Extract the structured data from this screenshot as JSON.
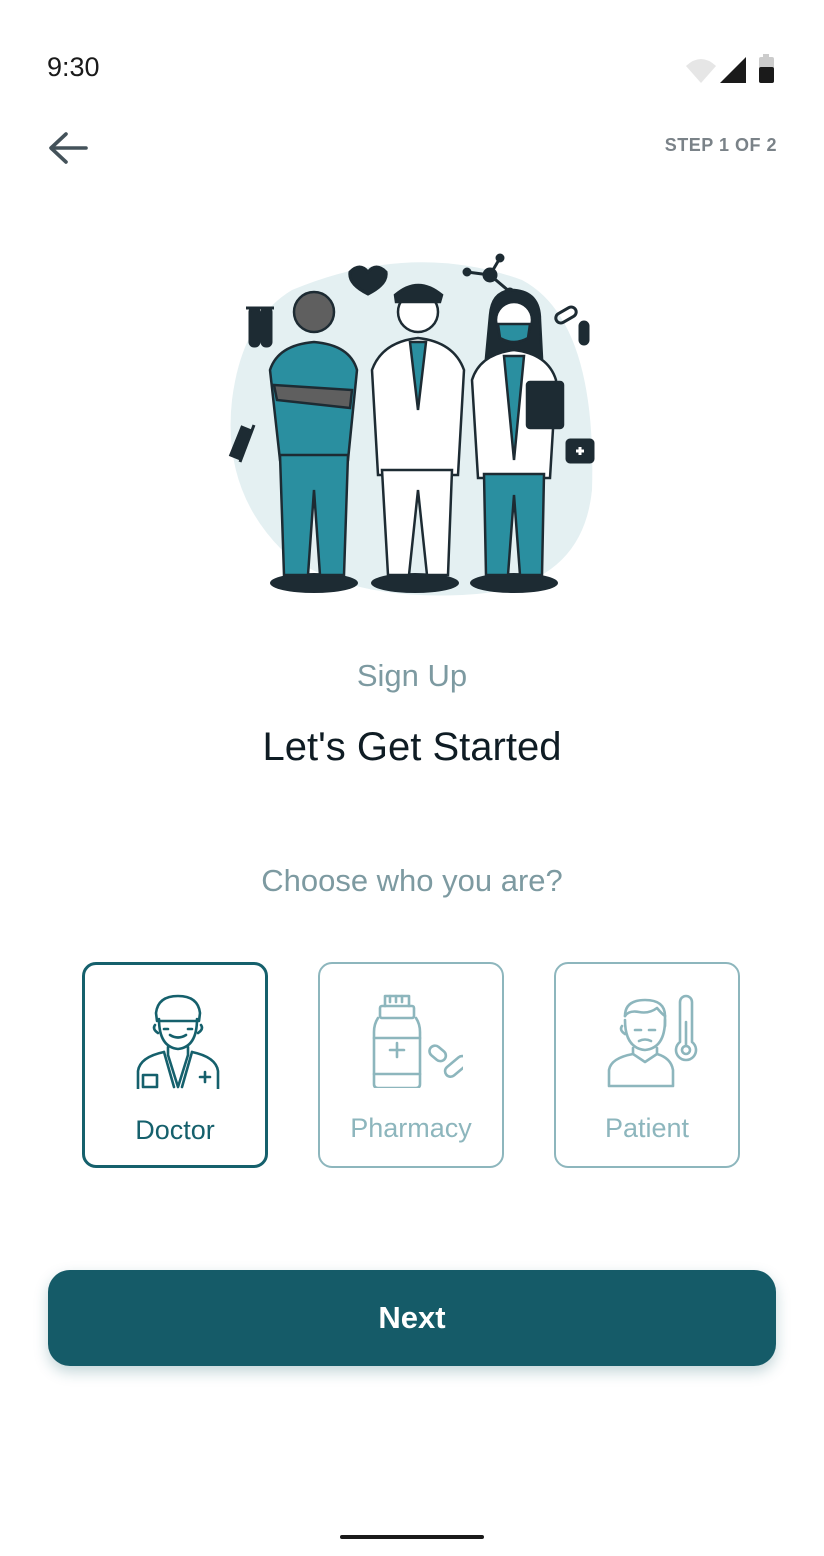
{
  "status_bar": {
    "time": "9:30"
  },
  "header": {
    "step": "STEP 1 OF 2",
    "back_icon": "arrow-left-icon"
  },
  "hero": {
    "illustration": "medical-team-illustration"
  },
  "text": {
    "subtitle": "Sign Up",
    "title": "Let's Get Started",
    "prompt": "Choose who you are?"
  },
  "roles": [
    {
      "label": "Doctor",
      "icon": "doctor-icon",
      "selected": true
    },
    {
      "label": "Pharmacy",
      "icon": "pharmacy-icon",
      "selected": false
    },
    {
      "label": "Patient",
      "icon": "patient-icon",
      "selected": false
    }
  ],
  "actions": {
    "next_label": "Next"
  },
  "colors": {
    "primary": "#155b68",
    "accent_teal": "#2a8fa0",
    "muted": "#8db6bd",
    "title": "#0f1c24",
    "subtle_text": "#7d9aa1"
  }
}
